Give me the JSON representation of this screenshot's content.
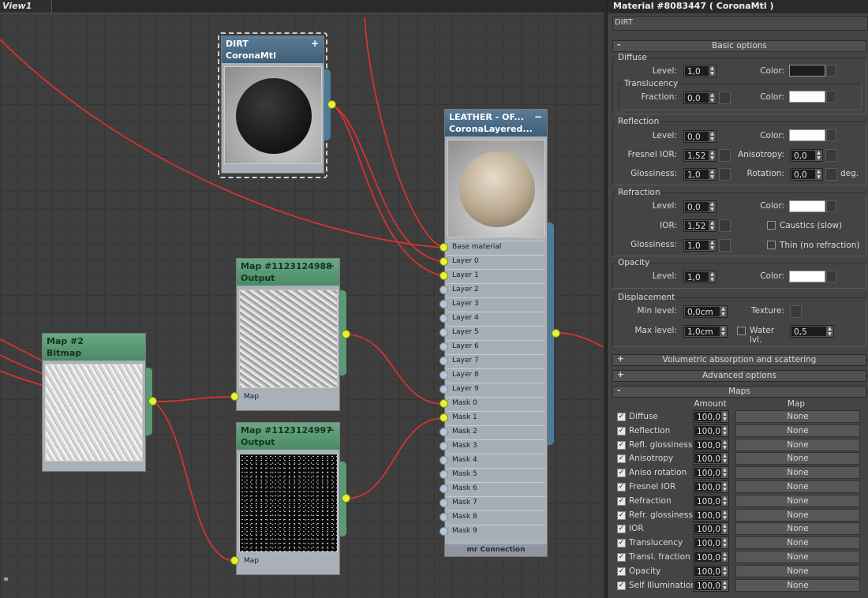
{
  "viewport": {
    "tab": "View1"
  },
  "nodes": {
    "dirt": {
      "title": "DIRT",
      "type": "CoronaMtl"
    },
    "leather": {
      "title": "LEATHER - OF...",
      "type": "CoronaLayered...",
      "slots": [
        "Base material",
        "Layer 0",
        "Layer 1",
        "Layer 2",
        "Layer 3",
        "Layer 4",
        "Layer 5",
        "Layer 6",
        "Layer 7",
        "Layer 8",
        "Layer 9",
        "Mask 0",
        "Mask 1",
        "Mask 2",
        "Mask 3",
        "Mask 4",
        "Mask 5",
        "Mask 6",
        "Mask 7",
        "Mask 8",
        "Mask 9"
      ],
      "connected_slots": [
        "Base material",
        "Layer 0",
        "Layer 1",
        "Mask 0",
        "Mask 1"
      ],
      "footer": "mr Connection"
    },
    "map_a": {
      "title": "Map #1123124988",
      "sub": "Output",
      "slot": "Map"
    },
    "map_b": {
      "title": "Map #1123124997",
      "sub": "Output",
      "slot": "Map"
    },
    "map2": {
      "title": "Map #2",
      "sub": "Bitmap"
    }
  },
  "colors": {
    "wire": "#e8302e",
    "socket_on": "#e4f23b",
    "material_header": "#4a6a84",
    "map_header": "#5a9a74"
  },
  "panel": {
    "title": "Material #8083447  ( CoronaMtl )",
    "name": "DIRT",
    "basic": {
      "header": "Basic options",
      "sign": "-",
      "diffuse": {
        "label": "Diffuse",
        "level_label": "Level:",
        "level": "1,0",
        "color_label": "Color:",
        "color": "#1e1c1c",
        "translucency": {
          "label": "Translucency",
          "fraction_label": "Fraction:",
          "fraction": "0,0",
          "color_label": "Color:",
          "color": "#ffffff"
        }
      },
      "reflection": {
        "label": "Reflection",
        "level_label": "Level:",
        "level": "0,0",
        "color_label": "Color:",
        "color": "#ffffff",
        "fresnel_label": "Fresnel IOR:",
        "fresnel": "1,52",
        "aniso_label": "Anisotropy:",
        "aniso": "0,0",
        "gloss_label": "Glossiness:",
        "gloss": "1,0",
        "rot_label": "Rotation:",
        "rot": "0,0",
        "deg": "deg."
      },
      "refraction": {
        "label": "Refraction",
        "level_label": "Level:",
        "level": "0,0",
        "color_label": "Color:",
        "color": "#ffffff",
        "ior_label": "IOR:",
        "ior": "1,52",
        "caustics": "Caustics (slow)",
        "gloss_label": "Glossiness:",
        "gloss": "1,0",
        "thin": "Thin (no refraction)"
      },
      "opacity": {
        "label": "Opacity",
        "level_label": "Level:",
        "level": "1,0",
        "color_label": "Color:",
        "color": "#ffffff"
      },
      "displacement": {
        "label": "Displacement",
        "min_label": "Min level:",
        "min": "0,0cm",
        "texture_label": "Texture:",
        "max_label": "Max level:",
        "max": "1,0cm",
        "water_label": "Water lvl.",
        "water": "0,5"
      }
    },
    "rollouts": [
      {
        "sign": "+",
        "label": "Volumetric absorption and scattering"
      },
      {
        "sign": "+",
        "label": "Advanced options"
      },
      {
        "sign": "-",
        "label": "Maps"
      }
    ],
    "maps": {
      "amount_header": "Amount",
      "map_header": "Map",
      "rows": [
        {
          "name": "Diffuse",
          "amount": "100,0",
          "map": "None"
        },
        {
          "name": "Reflection",
          "amount": "100,0",
          "map": "None"
        },
        {
          "name": "Refl. glossiness",
          "amount": "100,0",
          "map": "None"
        },
        {
          "name": "Anisotropy",
          "amount": "100,0",
          "map": "None"
        },
        {
          "name": "Aniso rotation",
          "amount": "100,0",
          "map": "None"
        },
        {
          "name": "Fresnel IOR",
          "amount": "100,0",
          "map": "None"
        },
        {
          "name": "Refraction",
          "amount": "100,0",
          "map": "None"
        },
        {
          "name": "Refr. glossiness",
          "amount": "100,0",
          "map": "None"
        },
        {
          "name": "IOR",
          "amount": "100,0",
          "map": "None"
        },
        {
          "name": "Translucency",
          "amount": "100,0",
          "map": "None"
        },
        {
          "name": "Transl. fraction",
          "amount": "100,0",
          "map": "None"
        },
        {
          "name": "Opacity",
          "amount": "100,0",
          "map": "None"
        },
        {
          "name": "Self Illumination",
          "amount": "100,0",
          "map": "None"
        }
      ]
    }
  }
}
